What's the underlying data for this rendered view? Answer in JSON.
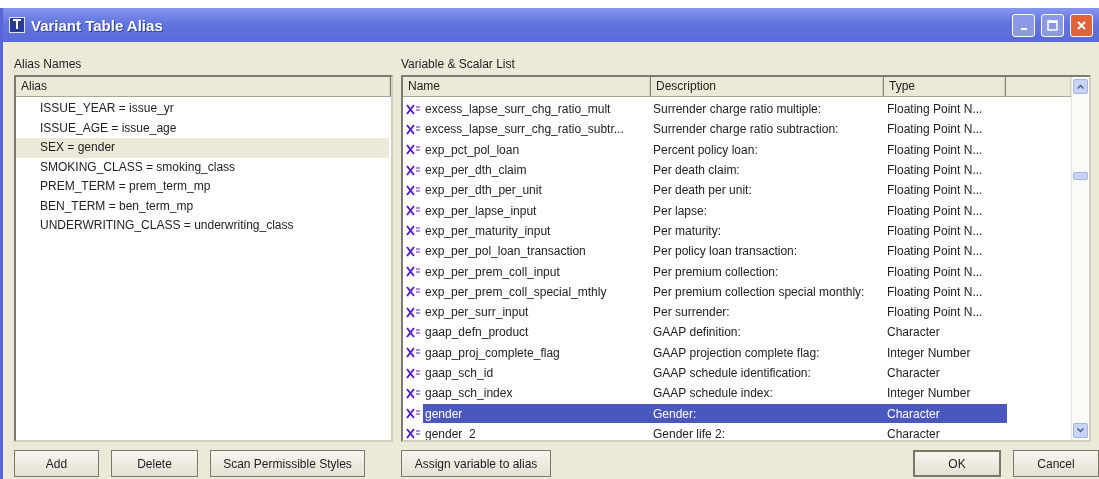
{
  "window": {
    "title": "Variant Table Alias"
  },
  "alias_panel": {
    "label": "Alias Names",
    "column": "Alias",
    "items": [
      {
        "text": "ISSUE_YEAR = issue_yr",
        "selected": false
      },
      {
        "text": "ISSUE_AGE = issue_age",
        "selected": false
      },
      {
        "text": "SEX = gender",
        "selected": true
      },
      {
        "text": "SMOKING_CLASS = smoking_class",
        "selected": false
      },
      {
        "text": "PREM_TERM = prem_term_mp",
        "selected": false
      },
      {
        "text": "BEN_TERM = ben_term_mp",
        "selected": false
      },
      {
        "text": "UNDERWRITING_CLASS = underwriting_class",
        "selected": false
      }
    ]
  },
  "variable_panel": {
    "label": "Variable & Scalar List",
    "columns": [
      "Name",
      "Description",
      "Type"
    ],
    "rows": [
      {
        "name": "excess_lapse_surr_chg_ratio_mult",
        "description": "Surrender charge ratio multiple:",
        "type": "Floating Point N...",
        "selected": false
      },
      {
        "name": "excess_lapse_surr_chg_ratio_subtr...",
        "description": "Surrender charge ratio subtraction:",
        "type": "Floating Point N...",
        "selected": false
      },
      {
        "name": "exp_pct_pol_loan",
        "description": "Percent policy loan:",
        "type": "Floating Point N...",
        "selected": false
      },
      {
        "name": "exp_per_dth_claim",
        "description": "Per death claim:",
        "type": "Floating Point N...",
        "selected": false
      },
      {
        "name": "exp_per_dth_per_unit",
        "description": "Per death per unit:",
        "type": "Floating Point N...",
        "selected": false
      },
      {
        "name": "exp_per_lapse_input",
        "description": "Per lapse:",
        "type": "Floating Point N...",
        "selected": false
      },
      {
        "name": "exp_per_maturity_input",
        "description": "Per maturity:",
        "type": "Floating Point N...",
        "selected": false
      },
      {
        "name": "exp_per_pol_loan_transaction",
        "description": "Per policy loan transaction:",
        "type": "Floating Point N...",
        "selected": false
      },
      {
        "name": "exp_per_prem_coll_input",
        "description": "Per premium collection:",
        "type": "Floating Point N...",
        "selected": false
      },
      {
        "name": "exp_per_prem_coll_special_mthly",
        "description": "Per premium collection special monthly:",
        "type": "Floating Point N...",
        "selected": false
      },
      {
        "name": "exp_per_surr_input",
        "description": "Per surrender:",
        "type": "Floating Point N...",
        "selected": false
      },
      {
        "name": "gaap_defn_product",
        "description": "GAAP definition:",
        "type": "Character",
        "selected": false
      },
      {
        "name": "gaap_proj_complete_flag",
        "description": "GAAP projection complete flag:",
        "type": "Integer Number",
        "selected": false
      },
      {
        "name": "gaap_sch_id",
        "description": "GAAP schedule identification:",
        "type": "Character",
        "selected": false
      },
      {
        "name": "gaap_sch_index",
        "description": "GAAP schedule index:",
        "type": "Integer Number",
        "selected": false
      },
      {
        "name": "gender",
        "description": "Gender:",
        "type": "Character",
        "selected": true
      },
      {
        "name": "gender_2",
        "description": "Gender life 2:",
        "type": "Character",
        "selected": false
      }
    ]
  },
  "left_buttons": [
    "Add",
    "Delete",
    "Scan Permissible Styles"
  ],
  "assign_button": "Assign variable to alias",
  "ok_button": "OK",
  "cancel_button": "Cancel"
}
